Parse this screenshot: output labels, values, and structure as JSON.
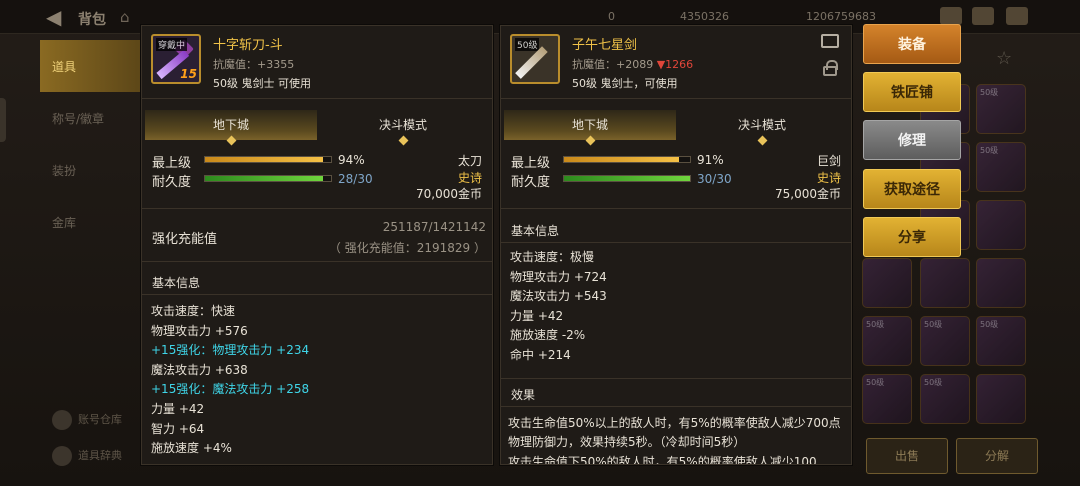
{
  "window": {
    "title": "背包",
    "currency_1": "0",
    "currency_2": "4350326",
    "currency_3": "1206759683"
  },
  "sidebar": {
    "items": [
      {
        "label": "道具"
      },
      {
        "label": "称号/徽章"
      },
      {
        "label": "装扮"
      },
      {
        "label": "金库"
      }
    ],
    "bottom_buttons": [
      {
        "label": "账号仓库"
      },
      {
        "label": "道具辞典"
      }
    ]
  },
  "inventory_actions": {
    "sell_label": "出售",
    "decompose_label": "分解"
  },
  "item_left": {
    "icon_tag": "穿戴中",
    "icon_level": "15",
    "name": "十字斩刀-斗",
    "resist_label": "抗魔值：",
    "resist_value": "+3355",
    "requirement": "50级 鬼剑士 可使用",
    "mode_tabs": [
      "地下城",
      "决斗模式"
    ],
    "grade_label": "最上级",
    "grade_percent": "94%",
    "grade_fraction": 0.94,
    "durability_label": "耐久度",
    "durability_text": "28/30",
    "durability_fraction": 0.933,
    "weapon_type": "太刀",
    "rarity": "史诗",
    "price": "70,000金币",
    "enhance_title": "强化充能值",
    "enhance_value": "251187/1421142",
    "enhance_sub": "（ 强化充能值：2191829 ）",
    "basic_title": "基本信息",
    "stats": [
      {
        "text": "攻击速度：快速",
        "type": "normal"
      },
      {
        "text": "物理攻击力 +576",
        "type": "normal"
      },
      {
        "text": "+15强化：物理攻击力 +234",
        "type": "enhance"
      },
      {
        "text": "魔法攻击力 +638",
        "type": "normal"
      },
      {
        "text": "+15强化：魔法攻击力 +258",
        "type": "enhance"
      },
      {
        "text": "力量 +42",
        "type": "normal"
      },
      {
        "text": "智力 +64",
        "type": "normal"
      },
      {
        "text": "施放速度 +4%",
        "type": "normal"
      }
    ]
  },
  "item_right": {
    "icon_level": "50级",
    "name": "子午七星剑",
    "resist_label": "抗魔值：",
    "resist_value": "+2089",
    "resist_diff": "▼1266",
    "requirement": "50级 鬼剑士，可使用",
    "mode_tabs": [
      "地下城",
      "决斗模式"
    ],
    "grade_label": "最上级",
    "grade_percent": "91%",
    "grade_fraction": 0.91,
    "durability_label": "耐久度",
    "durability_text": "30/30",
    "durability_fraction": 1.0,
    "weapon_type": "巨剑",
    "rarity": "史诗",
    "price": "75,000金币",
    "basic_title": "基本信息",
    "stats": [
      {
        "text": "攻击速度：极慢"
      },
      {
        "text": "物理攻击力 +724"
      },
      {
        "text": "魔法攻击力 +543"
      },
      {
        "text": "力量 +42"
      },
      {
        "text": "施放速度 -2%"
      },
      {
        "text": "命中 +214"
      }
    ],
    "effect_title": "效果",
    "effect_text": "攻击生命值50%以上的敌人时，有5%的概率使敌人减少700点物理防御力，效果持续5秒。（冷却时间5秒）",
    "effect_text_2": "攻击生命值下50%的敌人时，有5%的概率使敌人减少100"
  },
  "actions": [
    {
      "label": "装备",
      "style": "orange"
    },
    {
      "label": "铁匠铺",
      "style": "gold"
    },
    {
      "label": "修理",
      "style": "gray"
    },
    {
      "label": "获取途径",
      "style": "gold"
    },
    {
      "label": "分享",
      "style": "gold"
    }
  ]
}
